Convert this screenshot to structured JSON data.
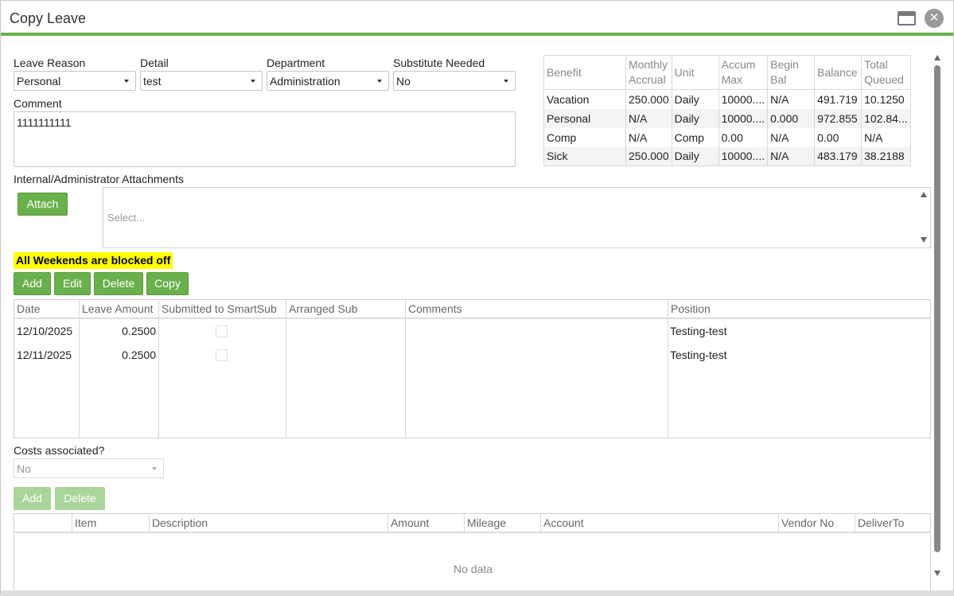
{
  "window": {
    "title": "Copy Leave"
  },
  "form": {
    "leave_reason_label": "Leave Reason",
    "leave_reason_value": "Personal",
    "detail_label": "Detail",
    "detail_value": "test",
    "department_label": "Department",
    "department_value": "Administration",
    "substitute_label": "Substitute Needed",
    "substitute_value": "No",
    "comment_label": "Comment",
    "comment_value": "1111111111"
  },
  "benefits": {
    "headers": [
      "Benefit",
      "Monthly Accrual",
      "Unit",
      "Accum Max",
      "Begin Bal",
      "Balance",
      "Total Queued"
    ],
    "rows": [
      [
        "Vacation",
        "250.000",
        "Daily",
        "10000....",
        "N/A",
        "491.719",
        "10.1250"
      ],
      [
        "Personal",
        "N/A",
        "Daily",
        "10000....",
        "0.000",
        "972.855",
        "102.84..."
      ],
      [
        "Comp",
        "N/A",
        "Comp",
        "0.00",
        "N/A",
        "0.00",
        "N/A"
      ],
      [
        "Sick",
        "250.000",
        "Daily",
        "10000....",
        "N/A",
        "483.179",
        "38.2188"
      ]
    ]
  },
  "attachments": {
    "label": "Internal/Administrator Attachments",
    "attach_button": "Attach",
    "placeholder": "Select..."
  },
  "banner": "All Weekends are blocked off",
  "leave_toolbar": {
    "add": "Add",
    "edit": "Edit",
    "delete": "Delete",
    "copy": "Copy"
  },
  "leave_grid": {
    "headers": [
      "Date",
      "Leave Amount",
      "Submitted to SmartSub",
      "Arranged Sub",
      "Comments",
      "Position"
    ],
    "rows": [
      {
        "date": "12/10/2025",
        "amount": "0.2500",
        "submitted": false,
        "arranged": "",
        "comments": "",
        "position": "Testing-test"
      },
      {
        "date": "12/11/2025",
        "amount": "0.2500",
        "submitted": false,
        "arranged": "",
        "comments": "",
        "position": "Testing-test"
      }
    ]
  },
  "costs": {
    "label": "Costs associated?",
    "value": "No",
    "add": "Add",
    "delete": "Delete",
    "headers": [
      "",
      "Item",
      "Description",
      "Amount",
      "Mileage",
      "Account",
      "Vendor No",
      "DeliverTo"
    ],
    "empty_text": "No data"
  },
  "icons": {
    "maximize": "maximize-icon",
    "close": "close-icon",
    "dropdown": "chevron-down-icon"
  },
  "colors": {
    "accent": "#6ab04c",
    "banner": "#ffff00"
  }
}
